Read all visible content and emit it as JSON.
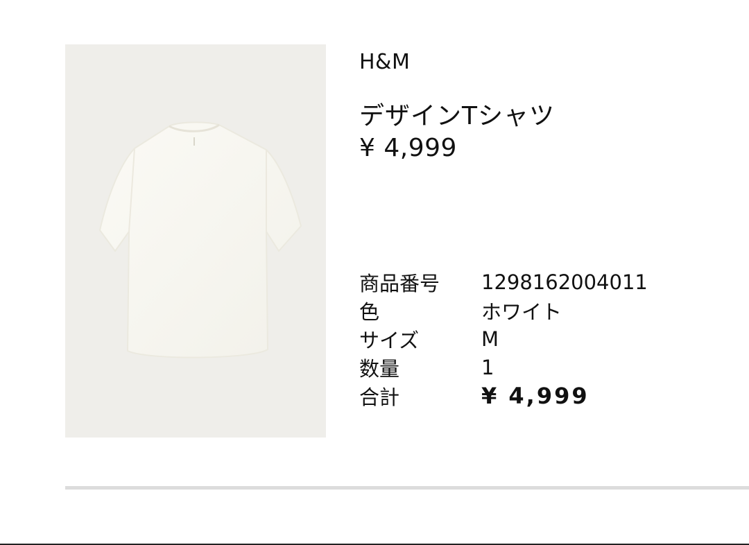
{
  "product": {
    "image_icon": "white-tshirt-image",
    "brand": "H&M",
    "name": "デザインTシャツ",
    "price": "¥ 4,999"
  },
  "details": {
    "rows": [
      {
        "label": "商品番号",
        "value": "1298162004011"
      },
      {
        "label": "色",
        "value": "ホワイト"
      },
      {
        "label": "サイズ",
        "value": "M"
      },
      {
        "label": "数量",
        "value": "1"
      },
      {
        "label": "合計",
        "value": "¥ 4,999"
      }
    ]
  },
  "colors": {
    "image_background": "#efeeea",
    "text": "#111111",
    "divider": "#dcdcdc"
  }
}
